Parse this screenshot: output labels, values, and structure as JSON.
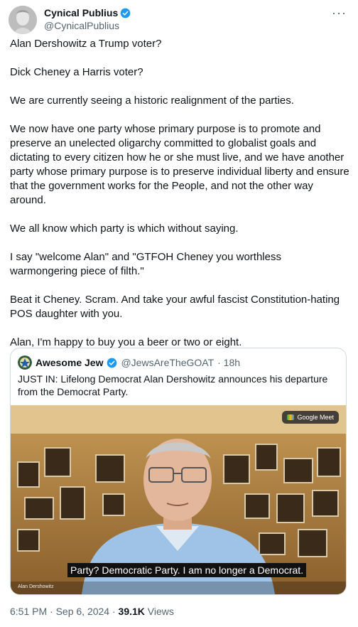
{
  "author": {
    "display_name": "Cynical Publius",
    "handle": "@CynicalPublius"
  },
  "more_label": "···",
  "body": [
    "Alan Dershowitz a Trump voter?",
    "Dick Cheney a Harris voter?",
    "We are currently seeing a historic realignment of the parties.",
    "We now have one party whose primary purpose is to promote and preserve an unelected oligarchy committed to globalist goals and dictating to every citizen how he or she must live, and we have another party whose primary purpose is to preserve individual liberty and ensure that the government works for the People, and not the other way around.",
    "We all know which party is which without saying.",
    "I say \"welcome Alan\" and \"GTFOH Cheney you worthless warmongering piece of filth.\"",
    "Beat it Cheney.  Scram.  And take your awful fascist Constitution-hating POS daughter with you.",
    "Alan, I'm happy to buy you a beer or two or eight."
  ],
  "quote": {
    "display_name": "Awesome Jew",
    "handle": "@JewsAreTheGOAT",
    "time": "· 18h",
    "text": "JUST IN: Lifelong Democrat Alan Dershowitz announces his departure from the Democrat Party.",
    "media": {
      "badge": "Google Meet",
      "caption": "Party? Democratic Party. I am no longer a Democrat.",
      "speaker_label": "Alan Dershowitz"
    }
  },
  "meta": {
    "timestamp": "6:51 PM · Sep 6, 2024 · ",
    "views_count": "39.1K",
    "views_label": " Views"
  },
  "colors": {
    "text": "#0f1419",
    "secondary": "#536471",
    "verified": "#1d9bf0",
    "border": "#cfd9de"
  }
}
